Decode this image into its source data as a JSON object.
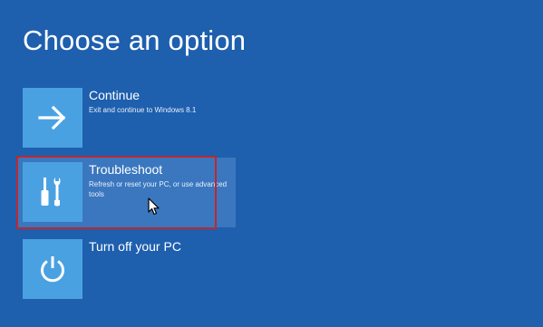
{
  "header": {
    "title": "Choose an option"
  },
  "options": [
    {
      "id": "continue",
      "icon": "arrow-right-icon",
      "label": "Continue",
      "description": "Exit and continue to Windows 8.1"
    },
    {
      "id": "troubleshoot",
      "icon": "tools-icon",
      "label": "Troubleshoot",
      "description": "Refresh or reset your PC, or use advanced tools",
      "highlighted": true
    },
    {
      "id": "turn-off",
      "icon": "power-icon",
      "label": "Turn off your PC",
      "description": ""
    }
  ],
  "colors": {
    "background": "#1e5fae",
    "tile": "#4aa1e2",
    "hover": "#3a77bf",
    "highlight_border": "#c0282d"
  }
}
